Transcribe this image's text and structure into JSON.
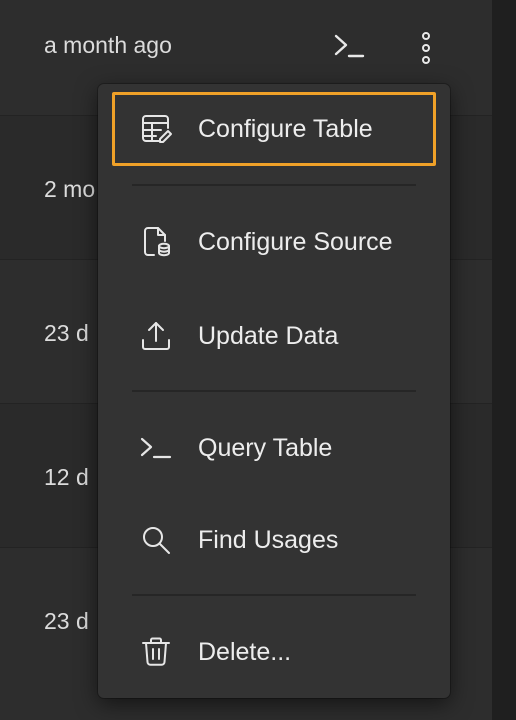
{
  "rows": [
    {
      "time": "a month ago"
    },
    {
      "time": "2 mo"
    },
    {
      "time": "23 d"
    },
    {
      "time": "12 d"
    },
    {
      "time": "23 d"
    }
  ],
  "row_actions": {
    "query_icon": "terminal-icon",
    "more_icon": "more-vertical-icon"
  },
  "menu": {
    "items": [
      {
        "label": "Configure Table",
        "icon": "table-edit-icon"
      },
      {
        "label": "Configure Source",
        "icon": "file-database-icon"
      },
      {
        "label": "Update Data",
        "icon": "upload-icon"
      },
      {
        "label": "Query Table",
        "icon": "terminal-icon"
      },
      {
        "label": "Find Usages",
        "icon": "search-icon"
      },
      {
        "label": "Delete...",
        "icon": "trash-icon"
      }
    ],
    "focus_color": "#f0a128"
  }
}
